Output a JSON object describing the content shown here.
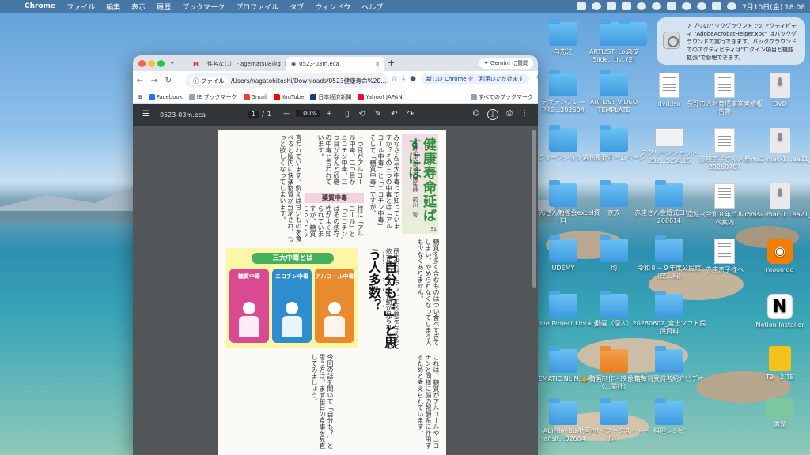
{
  "menubar": {
    "app_name": "Chrome",
    "items": [
      "ファイル",
      "編集",
      "表示",
      "履歴",
      "ブックマーク",
      "プロファイル",
      "タブ",
      "ウィンドウ",
      "ヘルプ"
    ],
    "clock": "7月10日(金) 18:08"
  },
  "notification": {
    "text": "アプリのバックグラウンドでのアクティビティ \"AdobeAcrobatHelper.xpc\" はバックグラウンドで実行できます。バックグラウンドでのアクティビティは\"ログイン項目と機能拡張\"で管理できます。"
  },
  "desktop": {
    "icons": [
      {
        "label": "与志江",
        "kind": "folder"
      },
      {
        "label": "ARTLIST_Lovely Slide...tist (2)",
        "kind": "folder"
      },
      {
        "label": "スプ",
        "kind": "folder"
      },
      {
        "label": "デオテンプレー PRE...202604",
        "kind": "folder"
      },
      {
        "label": "ARTLIST VIDEO TEMPLATE",
        "kind": "folder"
      },
      {
        "label": "dvd.iso",
        "kind": "doc"
      },
      {
        "label": "長野市人材育成事業実績報告書",
        "kind": "doc"
      },
      {
        "label": "DVD",
        "kind": "download"
      },
      {
        "label": "クリーンショット",
        "kind": "folder"
      },
      {
        "label": "週刊長野ホームページ",
        "kind": "folder"
      },
      {
        "label": "スクリーンショット 202...5.54.16",
        "kind": "screenshot"
      },
      {
        "label": "赤座京子さんメモ 20260707",
        "kind": "doc"
      },
      {
        "label": "mms2-mac-1...ea21_3",
        "kind": "download"
      },
      {
        "label": "りーんさん勉強会excel資料",
        "kind": "folder"
      },
      {
        "label": "家族",
        "kind": "folder"
      },
      {
        "label": "赤座さん金婚式コピー…260614",
        "kind": "folder"
      },
      {
        "label": "回覧（令和８年ゴルフコンペ案内",
        "kind": "doc"
      },
      {
        "label": "mms2-mac-1...ea21_3",
        "kind": "download"
      },
      {
        "label": "UDEMY",
        "kind": "folder"
      },
      {
        "label": "均",
        "kind": "folder"
      },
      {
        "label": "令和８－９年度公民館（窪…料）",
        "kind": "folder"
      },
      {
        "label": "赤座京子様へ",
        "kind": "doc"
      },
      {
        "label": "moomoo",
        "kind": "app-moomoo"
      },
      {
        "label": "esolve Project Library",
        "kind": "folder"
      },
      {
        "label": "動画（個人）",
        "kind": "folder"
      },
      {
        "label": "20260602_富士ソフト提供資料",
        "kind": "folder"
      },
      {
        "label": "Notion Installer",
        "kind": "app-notion"
      },
      {
        "label": "CINEMATIC NLIN....ASS",
        "kind": "folder"
      },
      {
        "label": "動画制作・映像編集（…関社）",
        "kind": "folder-orange"
      },
      {
        "label": "信毎賞受賞者紹介ビデオ",
        "kind": "folder"
      },
      {
        "label": "T9　2 TB",
        "kind": "drive"
      },
      {
        "label": "AL)Film Burn ransit...02604",
        "kind": "folder"
      },
      {
        "label": "動画PR（ファクス・メール）",
        "kind": "folder"
      },
      {
        "label": "料理レシピ",
        "kind": "folder"
      },
      {
        "label": "書類",
        "kind": "mail"
      }
    ]
  },
  "browser": {
    "tabs": [
      {
        "label": "（件名なし） - agematsu8@g",
        "active": false
      },
      {
        "label": "0523-03m.eca",
        "active": true
      }
    ],
    "gemini_label": "Gemini に質問",
    "omnibox": {
      "chip": "ファイル",
      "url": "/Users/nagatohitoshi/Downloads/0523健康寿命%20..."
    },
    "update_label": "新しい Chrome をご利用いただけます",
    "bookmarks": [
      "Facebook",
      "IE ブックマーク",
      "Gmail",
      "YouTube",
      "日本経済新聞",
      "Yahoo! JAPAN"
    ],
    "all_bookmarks": "すべてのブックマーク"
  },
  "pdf": {
    "filename": "0523-03m.eca",
    "page_current": "1",
    "page_sep": "/",
    "page_total": "1",
    "zoom": "100%",
    "zoom_minus": "—",
    "zoom_plus": "+"
  },
  "article": {
    "headline": "健康寿命延ばすには",
    "byline": "長野松代総合病院医師　前川　智",
    "issue_number": "51",
    "subhead": "薬質中毒",
    "box_title": "三大中毒とは",
    "panels": [
      "糖質中毒",
      "ニコチン中毒",
      "アルコール中毒"
    ],
    "big_question": "「自分も？」と思う人多数？",
    "columns": [
      "みなさん三大中毒って知っていますか？その三つの中毒とは「アルコール中毒」と「ニコチン中毒」そして「糖質中毒」ですが、",
      "一つ目がアルコール中毒、二つ目がニコチン中毒、三つ目がなんと砂糖の中毒と言われています。",
      "特に「アルコール」と「ニコチン」はその依存性がよく知られていますが、糖質についても同じような依存があると",
      "言われています。例えば甘いものを食べると脳内に快楽物質が分泌され、もっと欲しくなってしまいます。",
      "糖質を多く含むものはつい食べすぎてしまい、やめられなくなってしまう人も少なくありません。",
      "研究では、ラットに砂糖を与えると依存症のような行動が見られたことも報告されています。",
      "これは、糖質がアルコールやニコチンと同様に脳の報酬系に作用するためと考えられています。",
      "今回の話を聞いて「自分も？」と思う方は、まず毎日の食事を見直してみましょう。"
    ]
  }
}
